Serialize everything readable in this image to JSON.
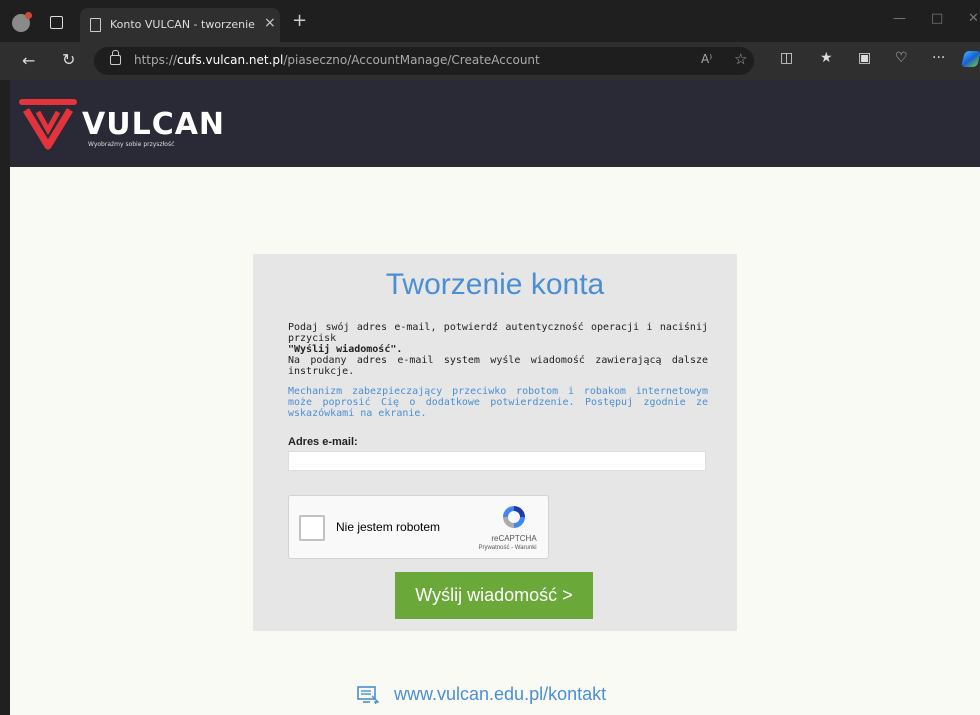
{
  "browser": {
    "tab_title": "Konto VULCAN - tworzenie konta",
    "tab_close": "×",
    "new_tab": "+",
    "url_prefix": "https://",
    "url_host": "cufs.vulcan.net.pl",
    "url_path": "/piaseczno/AccountManage/CreateAccount",
    "read_aloud": "A⁾",
    "more_label": "···",
    "minimize": "—",
    "maximize": "□",
    "close": "✕"
  },
  "header": {
    "logo_text": "VULCAN",
    "slogan": "Wyobraźmy sobie przyszłość",
    "brand_color": "#e3343b",
    "bg_color": "#2a2a36"
  },
  "form": {
    "title": "Tworzenie konta",
    "desc_line1": "Podaj swój adres e-mail, potwierdź autentyczność operacji i naciśnij przycisk",
    "desc_bold": "\"Wyślij wiadomość\".",
    "desc_line2": "Na podany adres e-mail system wyśle wiadomość zawierającą dalsze instrukcje.",
    "info": "Mechanizm zabezpieczający przeciwko robotom i robakom internetowym może poprosić Cię o dodatkowe potwierdzenie. Postępuj zgodnie ze wskazówkami na ekranie.",
    "email_label": "Adres e-mail:",
    "email_value": "",
    "captcha_label": "Nie jestem robotem",
    "captcha_brand": "reCAPTCHA",
    "captcha_links": "Prywatność - Warunki",
    "send_button": "Wyślij wiadomość >",
    "accent_color": "#4a8fd4",
    "button_color": "#6aa83a"
  },
  "footer": {
    "contact_link": "www.vulcan.edu.pl/kontakt"
  }
}
